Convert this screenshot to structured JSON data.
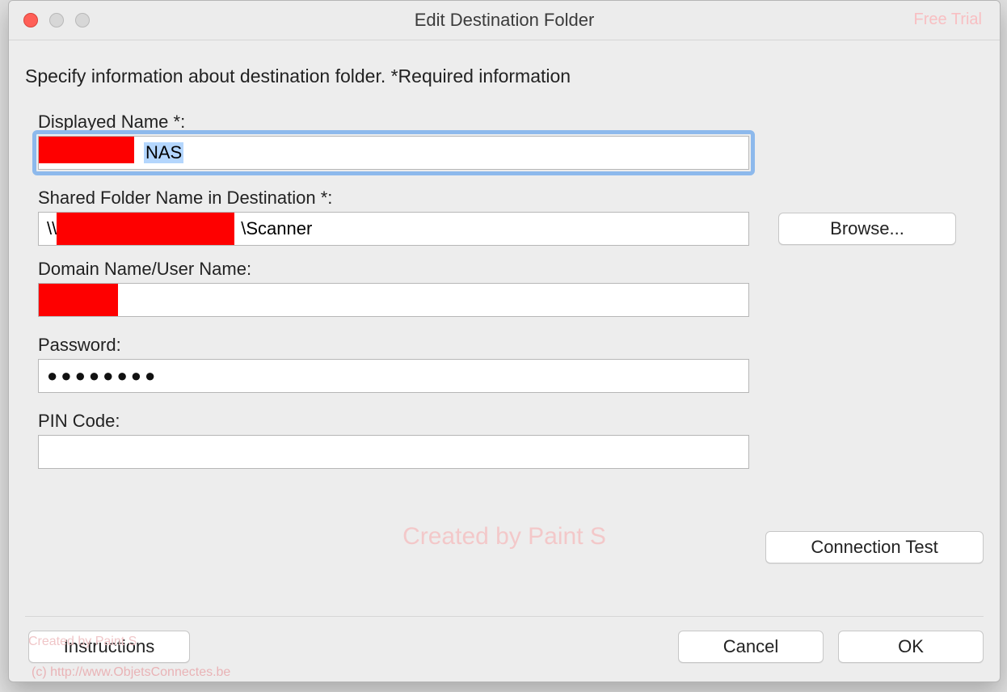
{
  "window": {
    "title": "Edit Destination Folder",
    "free_trial": "Free Trial"
  },
  "subtitle": "Specify information about destination folder. *Required information",
  "fields": {
    "displayed_name": {
      "label": "Displayed Name *:",
      "visible_value": "NAS"
    },
    "shared_folder": {
      "label": "Shared Folder Name in Destination *:",
      "prefix": "\\\\",
      "suffix": "\\Scanner"
    },
    "domain_user": {
      "label": "Domain Name/User Name:",
      "value": ""
    },
    "password": {
      "label": "Password:",
      "masked": "●●●●●●●●"
    },
    "pin": {
      "label": "PIN Code:",
      "value": ""
    }
  },
  "buttons": {
    "browse": "Browse...",
    "connection_test": "Connection Test",
    "instructions": "Instructions",
    "cancel": "Cancel",
    "ok": "OK"
  },
  "watermark": {
    "center": "Created by Paint S",
    "small": "Created by Paint S",
    "copyright": "(c) http://www.ObjetsConnectes.be"
  }
}
